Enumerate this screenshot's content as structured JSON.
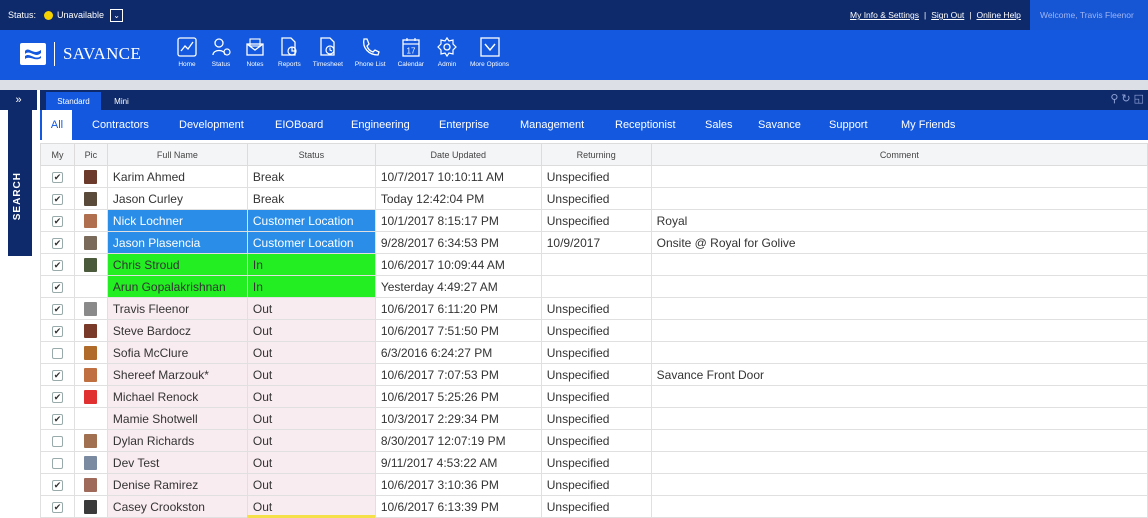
{
  "status_bar": {
    "label": "Status:",
    "value": "Unavailable",
    "dot_color": "#f5d200",
    "links": [
      "My Info & Settings",
      "Sign Out",
      "Online Help"
    ],
    "welcome": "Welcome, Travis Fleenor"
  },
  "brand": {
    "name": "SAVANCE"
  },
  "nav": [
    {
      "label": "Home",
      "icon": "home-chart-icon"
    },
    {
      "label": "Status",
      "icon": "status-person-icon"
    },
    {
      "label": "Notes",
      "icon": "notes-envelope-icon"
    },
    {
      "label": "Reports",
      "icon": "reports-icon"
    },
    {
      "label": "Timesheet",
      "icon": "timesheet-icon"
    },
    {
      "label": "Phone List",
      "icon": "phone-icon"
    },
    {
      "label": "Calendar",
      "icon": "calendar-icon",
      "day": "17"
    },
    {
      "label": "Admin",
      "icon": "gear-icon"
    },
    {
      "label": "More Options",
      "icon": "more-options-icon"
    }
  ],
  "sidebar": {
    "toggle": "»",
    "search_label": "SEARCH"
  },
  "view_tabs": [
    "Standard",
    "Mini"
  ],
  "group_tabs": [
    "All",
    "Contractors",
    "Development",
    "EIOBoard",
    "Engineering",
    "Enterprise",
    "Management",
    "Receptionist",
    "Sales",
    "Savance",
    "Support",
    "My Friends"
  ],
  "table": {
    "columns": [
      "My",
      "Pic",
      "Full Name",
      "Status",
      "Date Updated",
      "Returning",
      "Comment"
    ],
    "rows": [
      {
        "my": true,
        "name": "Karim Ahmed",
        "status": "Break",
        "date": "10/7/2017 10:10:11 AM",
        "returning": "Unspecified",
        "comment": ""
      },
      {
        "my": true,
        "name": "Jason Curley",
        "status": "Break",
        "date": "Today 12:42:04 PM",
        "returning": "Unspecified",
        "comment": ""
      },
      {
        "my": true,
        "name": "Nick Lochner",
        "status": "Customer Location",
        "date": "10/1/2017 8:15:17 PM",
        "returning": "Unspecified",
        "comment": "Royal"
      },
      {
        "my": true,
        "name": "Jason Plasencia",
        "status": "Customer Location",
        "date": "9/28/2017 6:34:53 PM",
        "returning": "10/9/2017",
        "comment": "Onsite @ Royal for Golive"
      },
      {
        "my": true,
        "name": "Chris Stroud",
        "status": "In",
        "date": "10/6/2017 10:09:44 AM",
        "returning": "",
        "comment": ""
      },
      {
        "my": true,
        "name": "Arun Gopalakrishnan",
        "status": "In",
        "date": "Yesterday 4:49:27 AM",
        "returning": "",
        "comment": ""
      },
      {
        "my": true,
        "name": "Travis Fleenor",
        "status": "Out",
        "date": "10/6/2017 6:11:20 PM",
        "returning": "Unspecified",
        "comment": ""
      },
      {
        "my": true,
        "name": "Steve Bardocz",
        "status": "Out",
        "date": "10/6/2017 7:51:50 PM",
        "returning": "Unspecified",
        "comment": ""
      },
      {
        "my": false,
        "name": "Sofia McClure",
        "status": "Out",
        "date": "6/3/2016 6:24:27 PM",
        "returning": "Unspecified",
        "comment": ""
      },
      {
        "my": true,
        "name": "Shereef Marzouk*",
        "status": "Out",
        "date": "10/6/2017 7:07:53 PM",
        "returning": "Unspecified",
        "comment": "Savance Front Door"
      },
      {
        "my": true,
        "name": "Michael Renock",
        "status": "Out",
        "date": "10/6/2017 5:25:26 PM",
        "returning": "Unspecified",
        "comment": ""
      },
      {
        "my": true,
        "name": "Mamie Shotwell",
        "status": "Out",
        "date": "10/3/2017 2:29:34 PM",
        "returning": "Unspecified",
        "comment": ""
      },
      {
        "my": false,
        "name": "Dylan Richards",
        "status": "Out",
        "date": "8/30/2017 12:07:19 PM",
        "returning": "Unspecified",
        "comment": ""
      },
      {
        "my": false,
        "name": "Dev Test",
        "status": "Out",
        "date": "9/11/2017 4:53:22 AM",
        "returning": "Unspecified",
        "comment": ""
      },
      {
        "my": true,
        "name": "Denise Ramirez",
        "status": "Out",
        "date": "10/6/2017 3:10:36 PM",
        "returning": "Unspecified",
        "comment": ""
      },
      {
        "my": true,
        "name": "Casey Crookston",
        "status": "Out",
        "date": "10/6/2017 6:13:39 PM",
        "returning": "Unspecified",
        "comment": ""
      }
    ]
  },
  "colors": {
    "customer_location": "#2a8ee8",
    "in": "#22ee22",
    "out": "#f9ecf1",
    "header_dark": "#0f2a6a",
    "header_blue": "#1358de"
  }
}
